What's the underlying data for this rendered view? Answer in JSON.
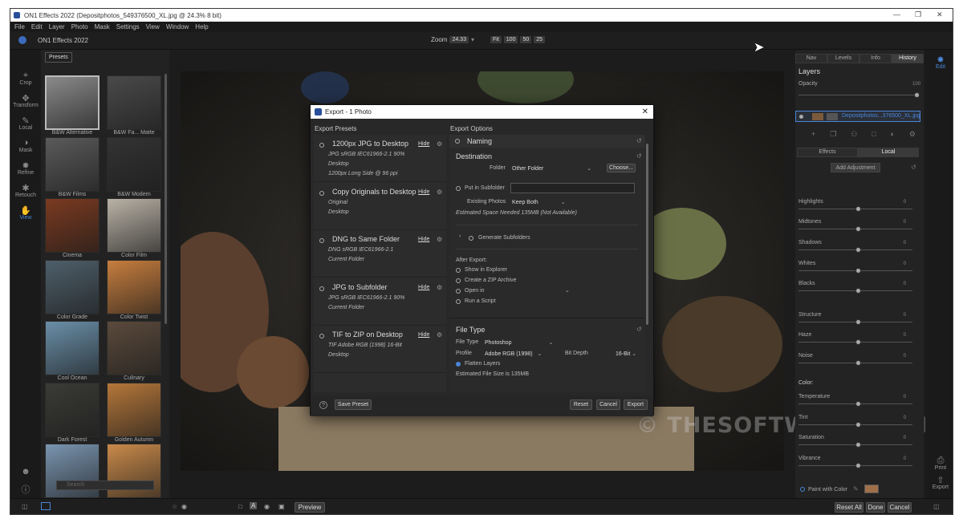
{
  "window": {
    "title": "ON1 Effects 2022 (Depositphotos_549376500_XL.jpg @ 24.3% 8 bit)"
  },
  "menu": [
    "File",
    "Edit",
    "Layer",
    "Photo",
    "Mask",
    "Settings",
    "View",
    "Window",
    "Help"
  ],
  "topbar": {
    "brand": "ON1 Effects 2022",
    "zoom_label": "Zoom",
    "zoom_value": "24.33",
    "fit": "Fit",
    "z100": "100",
    "z50": "50",
    "z25": "25"
  },
  "tools": [
    {
      "label": "Crop",
      "icon": "crop-icon"
    },
    {
      "label": "Transform",
      "icon": "move-icon"
    },
    {
      "label": "Local",
      "icon": "brush-icon"
    },
    {
      "label": "Mask",
      "icon": "mask-icon"
    },
    {
      "label": "Refine",
      "icon": "refine-icon"
    },
    {
      "label": "Retouch",
      "icon": "retouch-icon"
    },
    {
      "label": "View",
      "icon": "hand-icon"
    }
  ],
  "presets": {
    "tab": "Presets",
    "search_placeholder": "Search",
    "items": [
      {
        "label": "B&W Alternative",
        "color": "#8a8a8a"
      },
      {
        "label": "B&W Fa... Matte",
        "color": "#4a4a4a"
      },
      {
        "label": "B&W Films",
        "color": "#5a5a5a"
      },
      {
        "label": "B&W Modern",
        "color": "#333333"
      },
      {
        "label": "Cinema",
        "color": "#7a3a20"
      },
      {
        "label": "Color Film",
        "color": "#b9b2a6"
      },
      {
        "label": "Color Grade",
        "color": "#4e5f6a"
      },
      {
        "label": "Color Twist",
        "color": "#c77e3e"
      },
      {
        "label": "Cool Ocean",
        "color": "#6a8fa8"
      },
      {
        "label": "Culinary",
        "color": "#5b4a3c"
      },
      {
        "label": "Dark Forest",
        "color": "#3a3a36"
      },
      {
        "label": "Golden Autumn",
        "color": "#b5773a"
      },
      {
        "label": "",
        "color": "#7a95b0"
      },
      {
        "label": "",
        "color": "#c98a4a"
      }
    ]
  },
  "bottom": {
    "preview": "Preview",
    "reset_all": "Reset All",
    "done": "Done",
    "cancel": "Cancel"
  },
  "right": {
    "tabs": [
      "Nav",
      "Levels",
      "Info",
      "History"
    ],
    "layers_title": "Layers",
    "opacity_label": "Opacity",
    "opacity_value": "100",
    "layer_name": "Depositphotos...376500_XL.jpg",
    "subtabs": [
      "Effects",
      "Local"
    ],
    "add_adjustment": "Add Adjustment",
    "sliders": [
      {
        "label": "Highlights",
        "value": "0"
      },
      {
        "label": "Midtones",
        "value": "0"
      },
      {
        "label": "Shadows",
        "value": "0"
      },
      {
        "label": "Whites",
        "value": "0"
      },
      {
        "label": "Blacks",
        "value": "0"
      },
      {
        "label": "Structure",
        "value": "0"
      },
      {
        "label": "Haze",
        "value": "0"
      },
      {
        "label": "Noise",
        "value": "0"
      }
    ],
    "color_heading": "Color:",
    "color_sliders": [
      {
        "label": "Temperature",
        "value": "0"
      },
      {
        "label": "Tint",
        "value": "0"
      },
      {
        "label": "Saturation",
        "value": "0"
      },
      {
        "label": "Vibrance",
        "value": "0"
      }
    ],
    "paint_with_color": "Paint with Color",
    "paint_swatch": "#a0704a"
  },
  "edit_rail": {
    "edit": "Edit",
    "print": "Print",
    "export": "Export"
  },
  "watermark": "© THESOFTWARE.SHOP",
  "dialog": {
    "title": "Export - 1 Photo",
    "presets_head": "Export Presets",
    "options_head": "Export Options",
    "hide": "Hide",
    "presets": [
      {
        "name": "1200px JPG to Desktop",
        "lines": [
          "JPG  sRGB IEC61966-2.1  90%",
          "Desktop",
          "1200px Long Side @ 96 ppi"
        ]
      },
      {
        "name": "Copy Originals to Desktop",
        "lines": [
          "Original",
          "Desktop"
        ]
      },
      {
        "name": "DNG to Same Folder",
        "lines": [
          "DNG  sRGB IEC61966-2.1",
          "Current Folder"
        ]
      },
      {
        "name": "JPG to Subfolder",
        "lines": [
          "JPG  sRGB IEC61966-2.1  90%",
          "Current Folder"
        ]
      },
      {
        "name": "TIF to ZIP on Desktop",
        "lines": [
          "TIF  Adobe RGB (1998)  16-Bit",
          "Desktop"
        ]
      }
    ],
    "naming": "Naming",
    "destination": "Destination",
    "folder_label": "Folder",
    "folder_value": "Other Folder",
    "choose": "Choose...",
    "put_in_subfolder": "Put in Subfolder",
    "existing_photos_label": "Existing Photos",
    "existing_photos_value": "Keep Both",
    "space_needed": "Estimated Space Needed 135MB (Not Available)",
    "generate_subfolders": "Generate Subfolders",
    "after_export": "After Export:",
    "after_options": [
      "Show in Explorer",
      "Create a ZIP Archive",
      "Open in",
      "Run a Script"
    ],
    "file_type_head": "File Type",
    "file_type_label": "File Type",
    "file_type_value": "Photoshop",
    "profile_label": "Profile",
    "profile_value": "Adobe RGB (1998)",
    "bit_depth_label": "Bit Depth",
    "bit_depth_value": "16-Bit",
    "flatten_layers": "Flatten Layers",
    "file_size": "Estimated File Size is 135MB",
    "save_preset": "Save Preset",
    "reset": "Reset",
    "cancel": "Cancel",
    "export": "Export"
  }
}
